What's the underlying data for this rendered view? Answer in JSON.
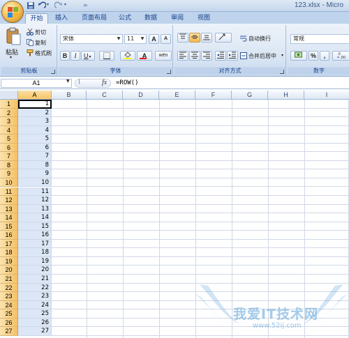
{
  "window": {
    "title": "123.xlsx - Micro"
  },
  "quick_access": {
    "separator": "=",
    "icons": [
      "save-icon",
      "undo-icon",
      "redo-icon"
    ]
  },
  "tabs": [
    {
      "label": "开始",
      "active": true
    },
    {
      "label": "插入"
    },
    {
      "label": "页面布局"
    },
    {
      "label": "公式"
    },
    {
      "label": "数据"
    },
    {
      "label": "审阅"
    },
    {
      "label": "视图"
    }
  ],
  "ribbon": {
    "clipboard": {
      "paste_label": "粘贴",
      "cut_label": "剪切",
      "copy_label": "复制",
      "format_painter_label": "格式刷",
      "group_label": "剪贴板"
    },
    "font": {
      "font_name": "宋体",
      "font_size": "11",
      "grow_label": "A",
      "shrink_label": "A",
      "bold_label": "B",
      "italic_label": "I",
      "underline_label": "U",
      "font_color_label": "A",
      "phonetic_label": "wén",
      "group_label": "字体"
    },
    "alignment": {
      "wrap_text_label": "自动换行",
      "merge_center_label": "合并后居中",
      "group_label": "对齐方式"
    },
    "number": {
      "format_value": "常规",
      "percent_label": "%",
      "comma_label": ",",
      "group_label": "数字"
    }
  },
  "formula_bar": {
    "name_box": "A1",
    "fx_label": "fx",
    "formula": "=ROW()"
  },
  "grid": {
    "columns": [
      "A",
      "B",
      "C",
      "D",
      "E",
      "F",
      "G",
      "H",
      "I"
    ],
    "selected_column": "A",
    "active_cell": "A1",
    "rows": [
      {
        "n": "1",
        "a": "1"
      },
      {
        "n": "2",
        "a": "2"
      },
      {
        "n": "3",
        "a": "3"
      },
      {
        "n": "4",
        "a": "4"
      },
      {
        "n": "5",
        "a": "5"
      },
      {
        "n": "6",
        "a": "6"
      },
      {
        "n": "7",
        "a": "7"
      },
      {
        "n": "8",
        "a": "8"
      },
      {
        "n": "9",
        "a": "9"
      },
      {
        "n": "10",
        "a": "10"
      },
      {
        "n": "11",
        "a": "11"
      },
      {
        "n": "12",
        "a": "12"
      },
      {
        "n": "13",
        "a": "13"
      },
      {
        "n": "14",
        "a": "14"
      },
      {
        "n": "15",
        "a": "15"
      },
      {
        "n": "16",
        "a": "16"
      },
      {
        "n": "17",
        "a": "17"
      },
      {
        "n": "18",
        "a": "18"
      },
      {
        "n": "19",
        "a": "19"
      },
      {
        "n": "20",
        "a": "20"
      },
      {
        "n": "21",
        "a": "21"
      },
      {
        "n": "22",
        "a": "22"
      },
      {
        "n": "23",
        "a": "23"
      },
      {
        "n": "24",
        "a": "24"
      },
      {
        "n": "25",
        "a": "25"
      },
      {
        "n": "26",
        "a": "26"
      },
      {
        "n": "27",
        "a": "27"
      }
    ]
  },
  "watermark": {
    "text": "我爱IT技术网",
    "url": "www.52ij.com"
  },
  "colors": {
    "accent": "#f5c163",
    "ribbon": "#dbe6f4",
    "selection": "#dbe6f6"
  }
}
